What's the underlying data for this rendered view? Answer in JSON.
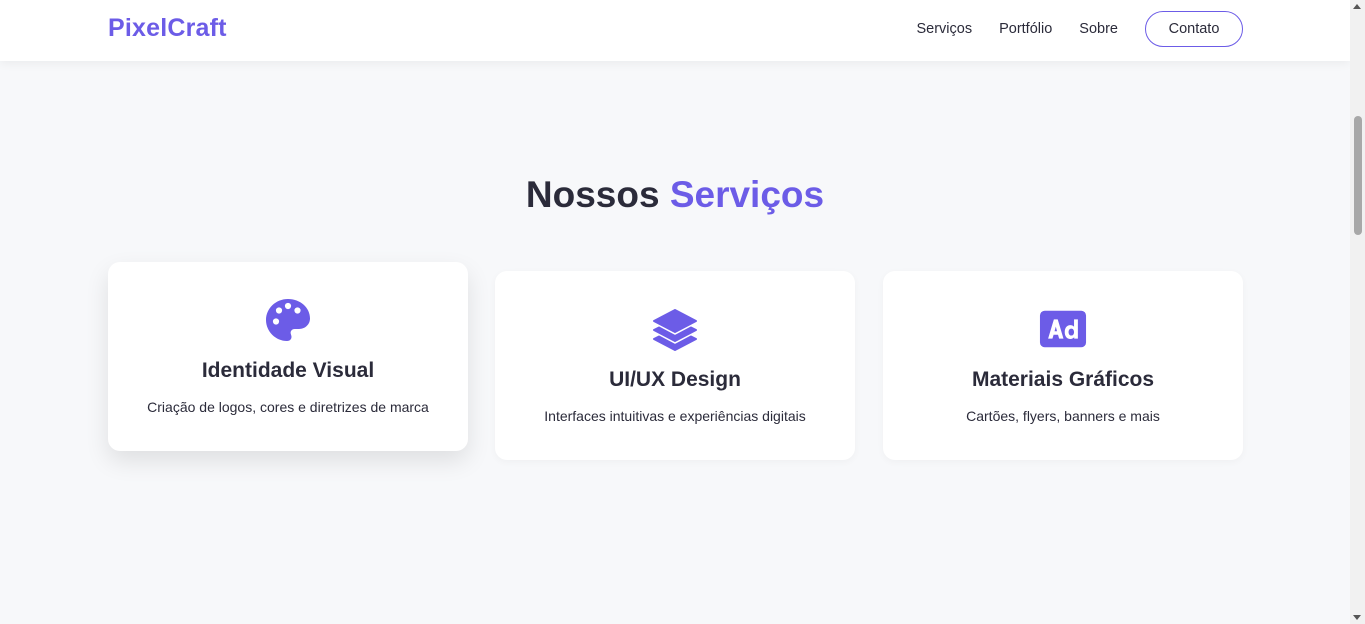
{
  "header": {
    "logo": "PixelCraft",
    "nav": [
      {
        "label": "Serviços"
      },
      {
        "label": "Portfólio"
      },
      {
        "label": "Sobre"
      }
    ],
    "cta_label": "Contato"
  },
  "services": {
    "title_main": "Nossos ",
    "title_accent": "Serviços",
    "accent_color": "#6c5ce7",
    "cards": [
      {
        "icon": "palette-icon",
        "title": "Identidade Visual",
        "description": "Criação de logos, cores e diretrizes de marca"
      },
      {
        "icon": "layers-icon",
        "title": "UI/UX Design",
        "description": "Interfaces intuitivas e experiências digitais"
      },
      {
        "icon": "ad-icon",
        "title": "Materiais Gráficos",
        "description": "Cartões, flyers, banners e mais"
      }
    ]
  }
}
